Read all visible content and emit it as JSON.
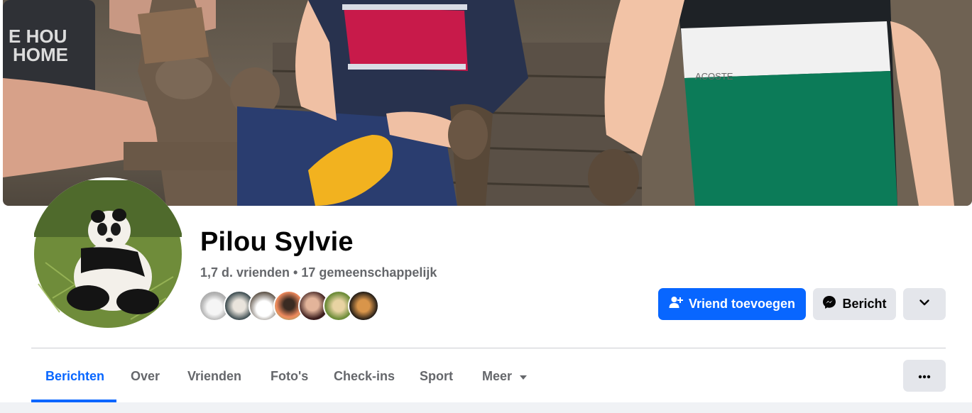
{
  "profile": {
    "name": "Pilou Sylvie",
    "friends_summary": "1,7 d. vrienden • 17 gemeenschappelijk",
    "mutual_friend_count_shown": 7
  },
  "actions": {
    "add_friend_label": "Vriend toevoegen",
    "message_label": "Bericht",
    "more_icon": "chevron-down-icon"
  },
  "tabs": [
    {
      "label": "Berichten",
      "active": true
    },
    {
      "label": "Over",
      "active": false
    },
    {
      "label": "Vrienden",
      "active": false
    },
    {
      "label": "Foto's",
      "active": false
    },
    {
      "label": "Check-ins",
      "active": false
    },
    {
      "label": "Sport",
      "active": false
    },
    {
      "label": "Meer",
      "active": false,
      "dropdown": true
    }
  ],
  "colors": {
    "accent": "#0866ff",
    "secondary_button": "#e4e6eb",
    "muted_text": "#65676b",
    "page_bg": "#f0f2f5"
  }
}
